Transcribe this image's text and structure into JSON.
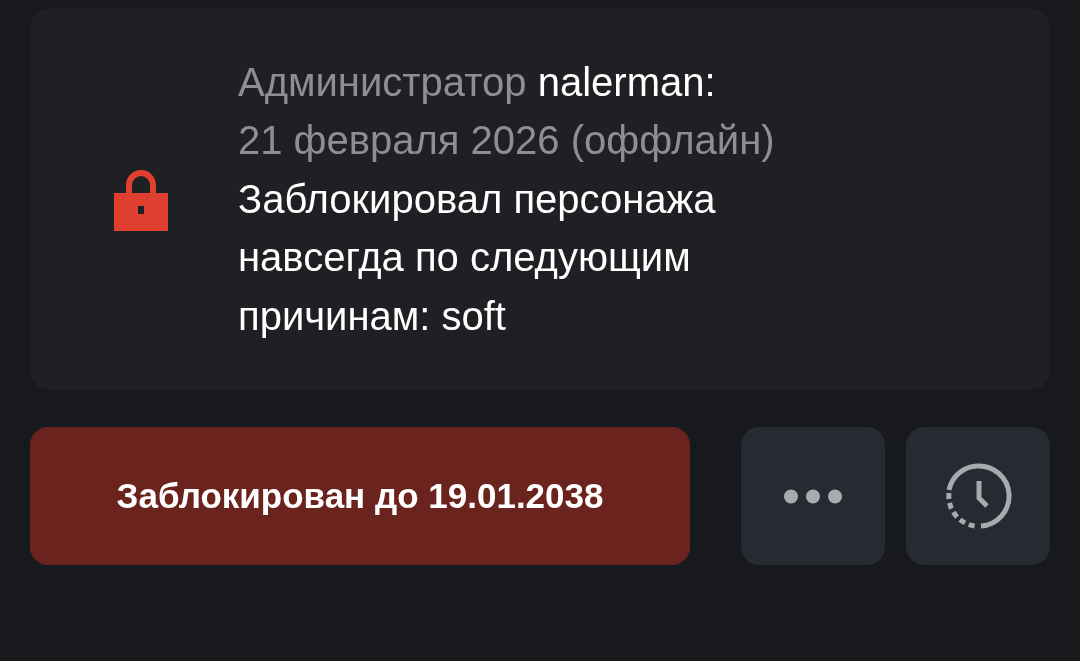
{
  "entry": {
    "role": "Администратор",
    "author": "nalerman:",
    "date": "21 февраля 2026 (оффлайн)",
    "message": "Заблокировал персонажа навсегда по следующим причинам: soft"
  },
  "actions": [
    {
      "kind": "status",
      "label": "Заблокирован до 19.01.2038"
    },
    {
      "kind": "more"
    },
    {
      "kind": "history"
    }
  ]
}
